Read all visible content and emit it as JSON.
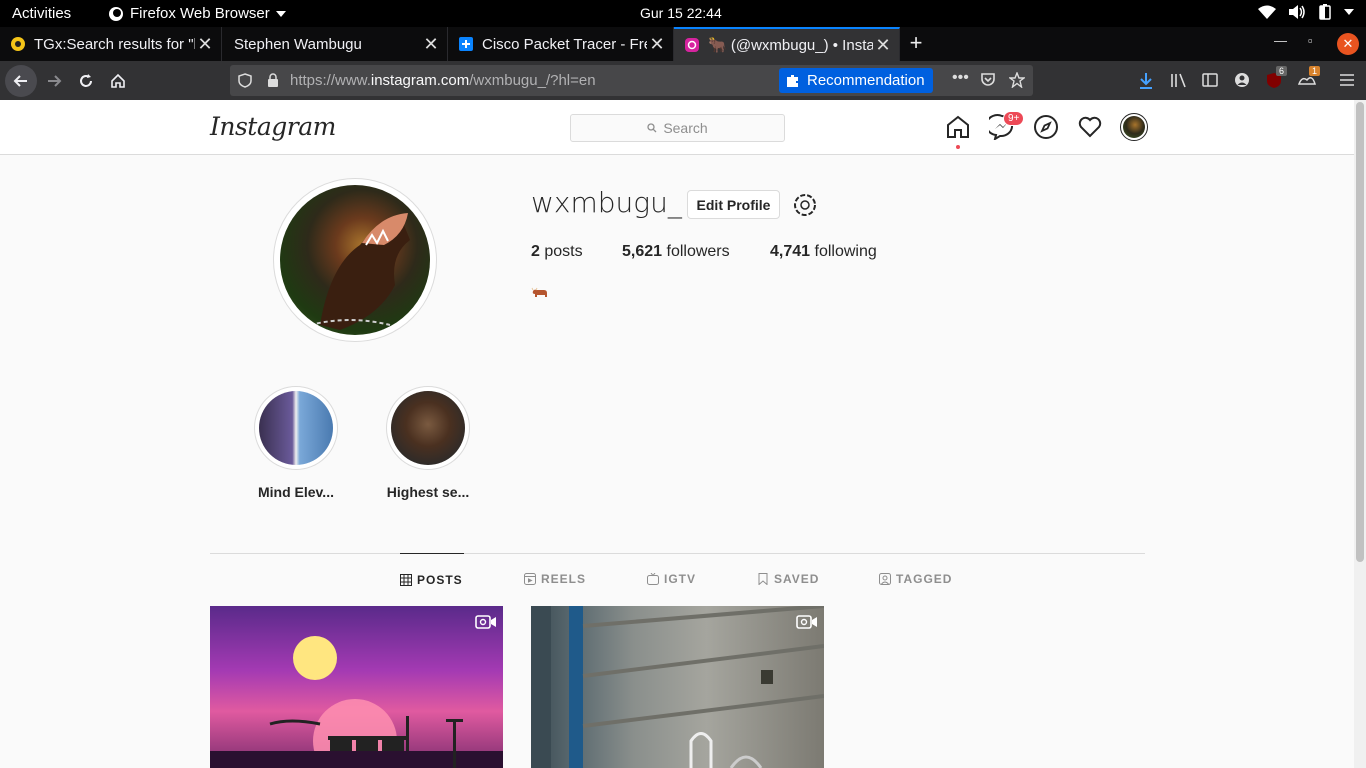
{
  "system": {
    "activities": "Activities",
    "app_name": "Firefox Web Browser",
    "clock": "Gur 15  22:44"
  },
  "browser": {
    "tabs": [
      {
        "title": "TGx:Search results for \"h",
        "icon": "tgx-favicon"
      },
      {
        "title": "Stephen Wambugu",
        "icon": "none"
      },
      {
        "title": "Cisco Packet Tracer - Fre",
        "icon": "puzzle-favicon"
      },
      {
        "title": "🐂 (@wxmbugu_) • Insta",
        "icon": "instagram-favicon",
        "active": true
      }
    ],
    "url_prefix": "https://www.",
    "url_domain": "instagram.com",
    "url_path": "/wxmbugu_/?hl=en",
    "recommendation": "Recommendation",
    "ublock_count": "6",
    "ext_badge": "1",
    "accent": "#0a84ff"
  },
  "instagram": {
    "logo": "Instagram",
    "search_placeholder": "Search",
    "dm_badge": "9+",
    "profile": {
      "username": "wxmbugu_",
      "edit_label": "Edit Profile",
      "posts_count": "2",
      "posts_label": "posts",
      "followers_count": "5,621",
      "followers_label": "followers",
      "following_count": "4,741",
      "following_label": "following",
      "bio_emoji": "ox-emoji"
    },
    "highlights": [
      {
        "label": "Mind Elev..."
      },
      {
        "label": "Highest se..."
      }
    ],
    "profile_tabs": [
      {
        "label": "POSTS",
        "active": true
      },
      {
        "label": "REELS"
      },
      {
        "label": "IGTV"
      },
      {
        "label": "SAVED"
      },
      {
        "label": "TAGGED"
      }
    ],
    "badge_color": "#ed4956"
  }
}
